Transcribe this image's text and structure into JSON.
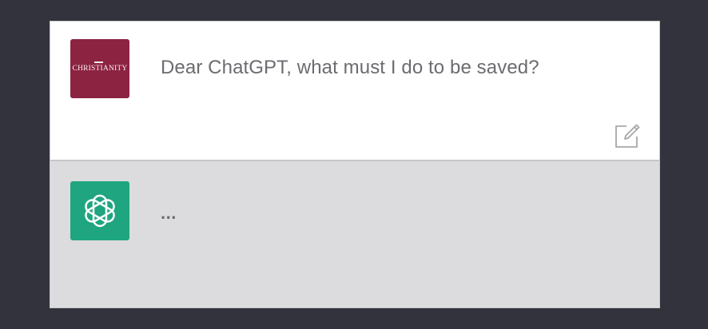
{
  "conversation": {
    "user": {
      "avatar_text": "CHRISTIANITY",
      "message": "Dear ChatGPT, what must I do to be saved?",
      "edit_icon": "edit-icon"
    },
    "assistant": {
      "avatar_icon": "openai-logo-icon",
      "message": "..."
    }
  },
  "colors": {
    "background": "#33333d",
    "user_avatar": "#8c2341",
    "assistant_avatar": "#1fa57f",
    "user_row": "#ffffff",
    "assistant_row": "#dcdbdd",
    "text": "#6c6b70"
  }
}
